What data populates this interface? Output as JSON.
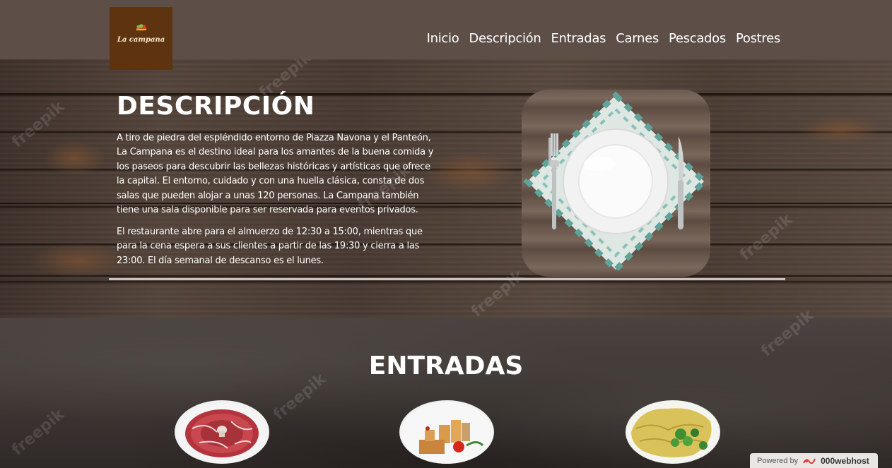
{
  "brand": {
    "logo_text": "La campana"
  },
  "nav": {
    "items": [
      "Inicio",
      "Descripción",
      "Entradas",
      "Carnes",
      "Pescados",
      "Postres"
    ]
  },
  "descripcion": {
    "title": "DESCRIPCIÓN",
    "paragraph1": "A tiro de piedra del espléndido entorno de Piazza Navona y el Panteón, La Campana es el destino ideal para los amantes de la buena comida y los paseos para descubrir las bellezas históricas y artísticas que ofrece la capital. El entorno, cuidado y con una huella clásica, consta de dos salas que pueden alojar a unas 120 personas. La Campana también tiene una sala disponible para ser reservada para eventos privados.",
    "paragraph2": "El restaurante abre para el almuerzo de 12:30 a 15:00, mientras que para la cena espera a sus clientes a partir de las 19:30 y cierra a las 23:00. El día semanal de descanso es el lunes."
  },
  "entradas": {
    "title": "ENTRADAS"
  },
  "footer_badge": {
    "powered_by": "Powered by",
    "host": "000webhost"
  },
  "watermark": "freepik",
  "colors": {
    "header_bg": "#5d4e48",
    "logo_bg": "#5e3410"
  }
}
